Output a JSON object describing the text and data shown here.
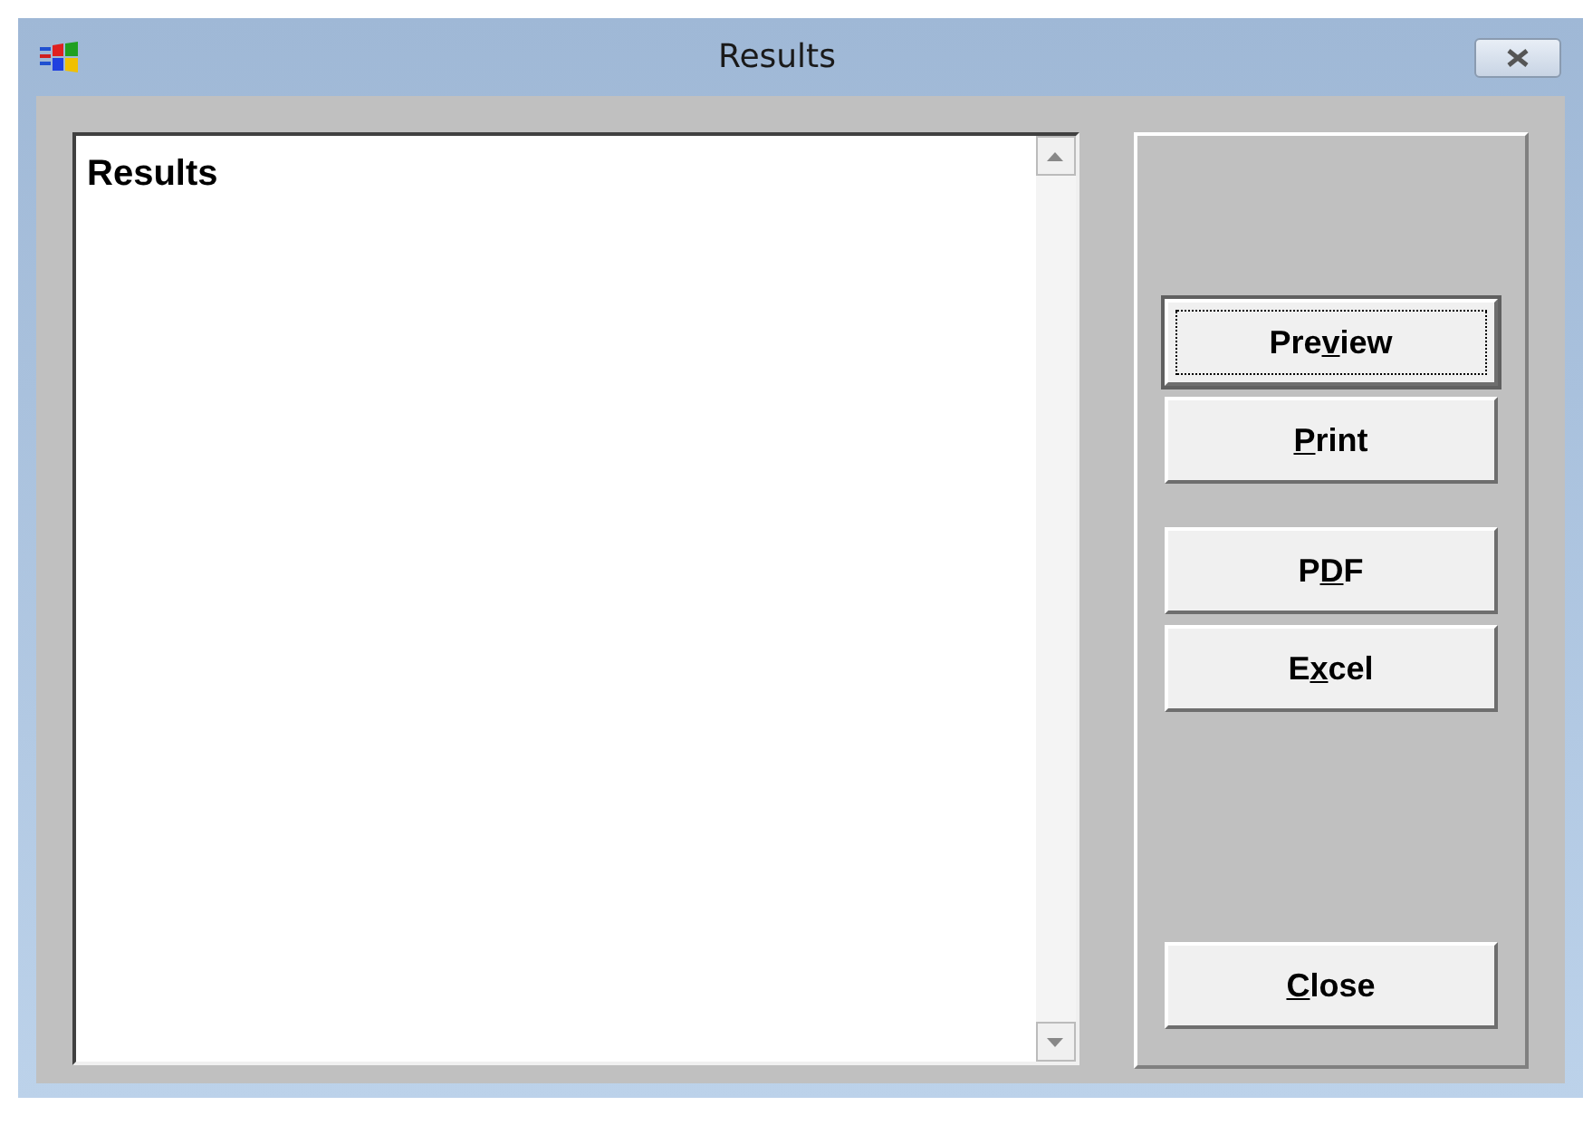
{
  "window": {
    "title": "Results"
  },
  "results_box": {
    "text": "Results"
  },
  "button_groups": [
    [
      {
        "before": "Pre",
        "key": "v",
        "after": "iew",
        "focused": true
      },
      {
        "key": "P",
        "after": "rint",
        "focused": false
      }
    ],
    [
      {
        "before": "P",
        "key": "D",
        "after": "F",
        "focused": false
      },
      {
        "before": "E",
        "key": "x",
        "after": "cel",
        "focused": false
      }
    ],
    [
      {
        "key": "C",
        "after": "lose",
        "focused": false
      }
    ]
  ]
}
